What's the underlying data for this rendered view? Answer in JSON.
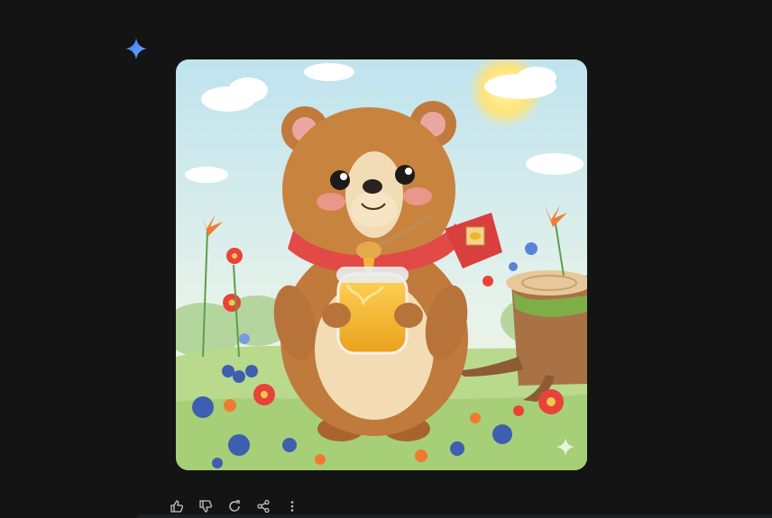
{
  "response": {
    "avatar_icon": "gemini-sparkle-icon",
    "image": {
      "subject_icon": "bear-with-honey-jar-illustration"
    }
  },
  "actions": [
    {
      "name": "thumbs-up-icon"
    },
    {
      "name": "thumbs-down-icon"
    },
    {
      "name": "regenerate-icon"
    },
    {
      "name": "share-icon"
    },
    {
      "name": "more-options-icon"
    }
  ],
  "colors": {
    "background": "#141414",
    "sparkle_blue": "#4a8cf7",
    "icon_gray": "#c4c7c5",
    "input_surface": "#1e1f20"
  }
}
